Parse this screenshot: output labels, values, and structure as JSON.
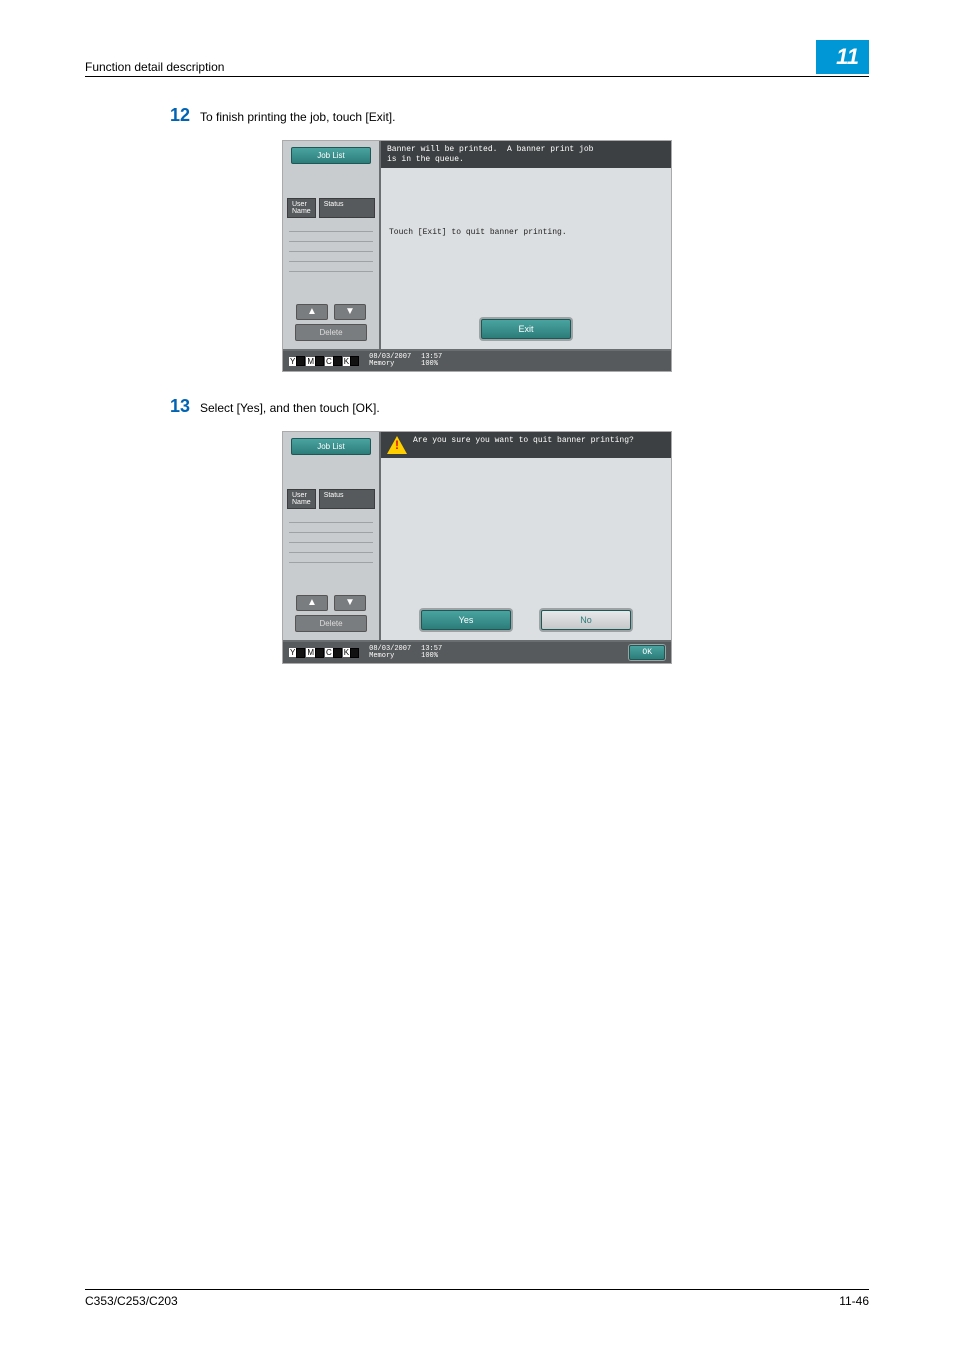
{
  "header": {
    "section": "Function detail description",
    "chapter": "11"
  },
  "steps": {
    "s12": {
      "num": "12",
      "text": "To finish printing the job, touch [Exit]."
    },
    "s13": {
      "num": "13",
      "text": "Select [Yes], and then touch [OK]."
    }
  },
  "panel1": {
    "job_list": "Job List",
    "user_name": "User\nName",
    "status": "Status",
    "delete": "Delete",
    "msg_top": "Banner will be printed.  A banner print job\nis in the queue.",
    "center_msg": "Touch [Exit] to quit banner printing.",
    "exit": "Exit",
    "date": "08/03/2007",
    "time": "13:57",
    "memory": "Memory",
    "mem_pct": "100%"
  },
  "panel2": {
    "job_list": "Job List",
    "user_name": "User\nName",
    "status": "Status",
    "delete": "Delete",
    "msg_top": "Are you sure you want to quit banner printing?",
    "yes": "Yes",
    "no": "No",
    "ok": "OK",
    "date": "08/03/2007",
    "time": "13:57",
    "memory": "Memory",
    "mem_pct": "100%"
  },
  "toner": {
    "y": "Y",
    "m": "M",
    "c": "C",
    "k": "K"
  },
  "footer": {
    "model": "C353/C253/C203",
    "page": "11-46"
  }
}
